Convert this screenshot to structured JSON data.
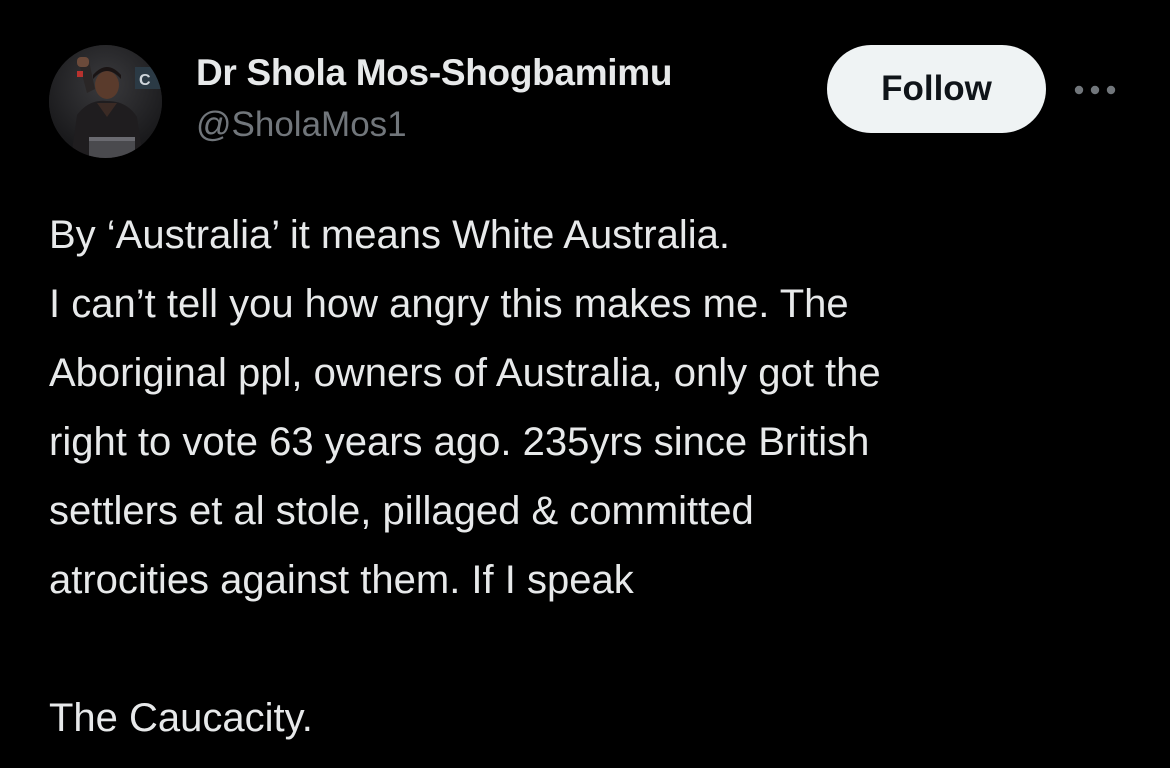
{
  "author": {
    "display_name": "Dr Shola Mos-Shogbamimu",
    "handle": "@SholaMos1"
  },
  "actions": {
    "follow_label": "Follow",
    "more_icon": "more-horizontal-icon"
  },
  "tweet": {
    "lines": [
      "By ‘Australia’ it means White Australia.",
      "I can’t tell you how angry this makes me. The",
      "Aboriginal ppl, owners of Australia, only got the",
      "right to vote 63 years ago. 235yrs since British",
      "settlers et al stole, pillaged & committed",
      "atrocities against them. If I speak"
    ],
    "closing": "The Caucacity."
  },
  "colors": {
    "background": "#000000",
    "primary_text": "#e7e9ea",
    "secondary_text": "#71767b",
    "follow_button_bg": "#eff3f4",
    "follow_button_text": "#0f1419"
  }
}
